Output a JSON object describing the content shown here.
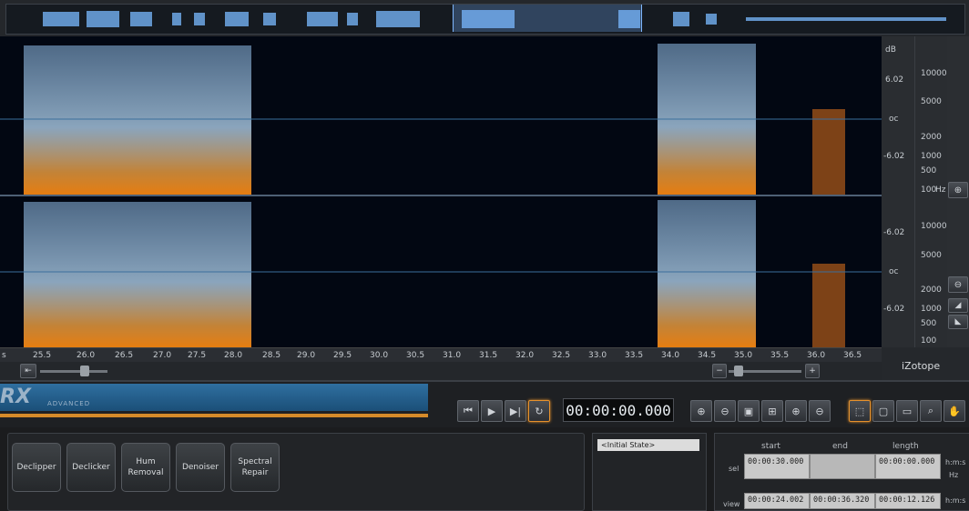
{
  "app": {
    "logo": "RX",
    "edition": "ADVANCED",
    "brand": "iZotope"
  },
  "amp_labels_top": [
    "dB",
    "6.02",
    "oc",
    "-6.02"
  ],
  "amp_labels_bottom": [
    "-6.02",
    "oc",
    "-6.02"
  ],
  "freq_labels_top": [
    "10000",
    "5000",
    "2000",
    "1000",
    "500",
    "100",
    "Hz"
  ],
  "freq_labels_bottom": [
    "10000",
    "5000",
    "2000",
    "1000",
    "500",
    "100"
  ],
  "time_ticks": [
    "s",
    "25.5",
    "26.0",
    "26.5",
    "27.0",
    "27.5",
    "28.0",
    "28.5",
    "29.0",
    "29.5",
    "30.0",
    "30.5",
    "31.0",
    "31.5",
    "32.0",
    "32.5",
    "33.0",
    "33.5",
    "34.0",
    "34.5",
    "35.0",
    "35.5",
    "36.0",
    "36.5"
  ],
  "transport": {
    "timecode": "00:00:00.000"
  },
  "modules": [
    {
      "id": "declipper",
      "label": "Declipper"
    },
    {
      "id": "declicker",
      "label": "Declicker"
    },
    {
      "id": "hum",
      "label": "Hum Removal"
    },
    {
      "id": "denoiser",
      "label": "Denoiser"
    },
    {
      "id": "spectral",
      "label": "Spectral Repair"
    }
  ],
  "history": {
    "items": [
      "<Initial State>"
    ]
  },
  "selection": {
    "headers": [
      "start",
      "end",
      "length"
    ],
    "rows": [
      {
        "label": "sel",
        "start": "00:00:30.000",
        "end": "",
        "length": "00:00:00.000"
      },
      {
        "label": "view",
        "start": "00:00:24.002",
        "end": "00:00:36.320",
        "length": "00:00:12.126"
      }
    ],
    "units": [
      "h:m:s",
      "Hz",
      "h:m:s"
    ]
  },
  "colors": {
    "accent": "#e7922c",
    "spectro_bg": "#020712",
    "band": "#2f6fa0"
  }
}
